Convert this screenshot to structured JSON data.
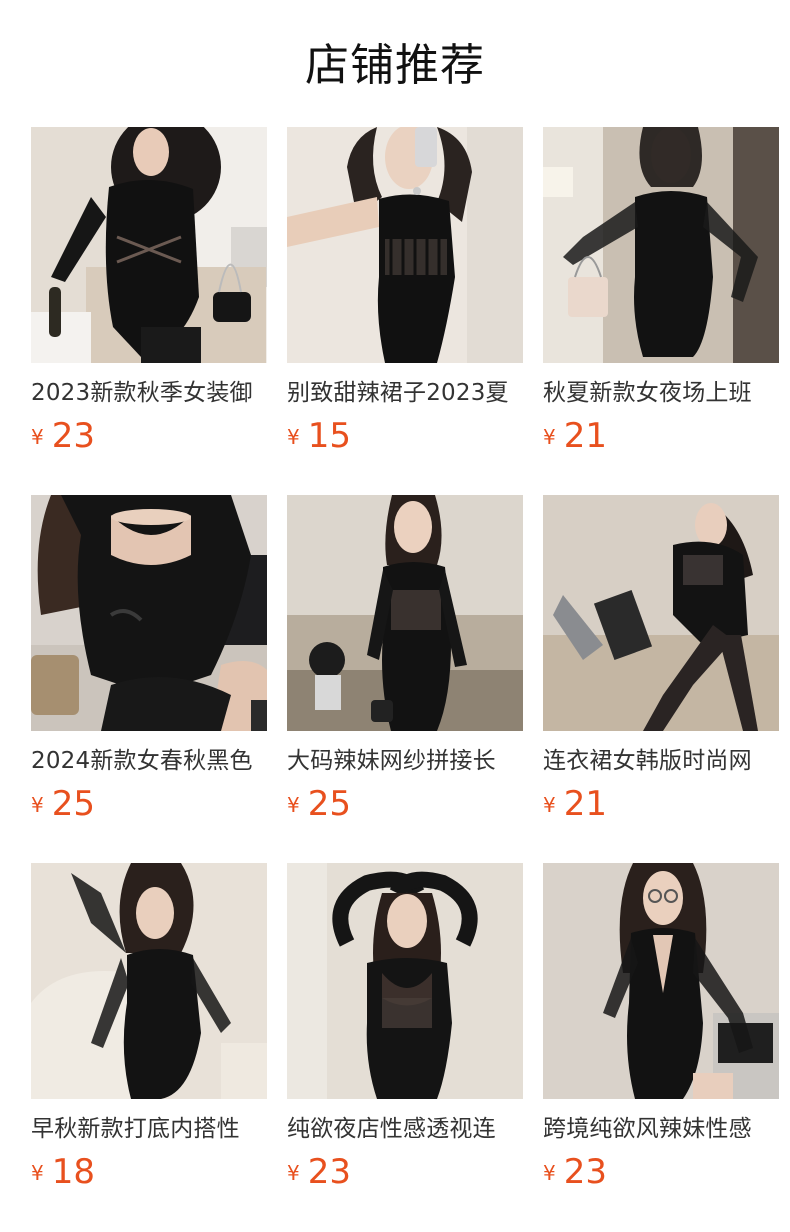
{
  "header": {
    "title": "店铺推荐"
  },
  "currency_symbol": "¥",
  "products": [
    {
      "name": "2023新款秋季女装御",
      "price": "23",
      "photo": "woman-black-mesh-dress-mirror-selfie"
    },
    {
      "name": "别致甜辣裙子2023夏",
      "price": "15",
      "photo": "woman-black-corset-dress-selfie"
    },
    {
      "name": "秋夏新款女夜场上班",
      "price": "21",
      "photo": "woman-black-square-neck-dress"
    },
    {
      "name": "2024新款女春秋黑色",
      "price": "25",
      "photo": "woman-black-ruched-dress-seated"
    },
    {
      "name": "大码辣妹网纱拼接长",
      "price": "25",
      "photo": "woman-black-long-mesh-dress-sofa"
    },
    {
      "name": "连衣裙女韩版时尚网",
      "price": "21",
      "photo": "woman-black-dress-laptop"
    },
    {
      "name": "早秋新款打底内搭性",
      "price": "18",
      "photo": "woman-black-dress-armchair"
    },
    {
      "name": "纯欲夜店性感透视连",
      "price": "23",
      "photo": "woman-black-sheer-dress-arms-up"
    },
    {
      "name": "跨境纯欲风辣妹性感",
      "price": "23",
      "photo": "woman-black-vneck-dress-glasses"
    }
  ],
  "colors": {
    "price": "#e8501e",
    "title": "#111111",
    "name": "#333333"
  }
}
